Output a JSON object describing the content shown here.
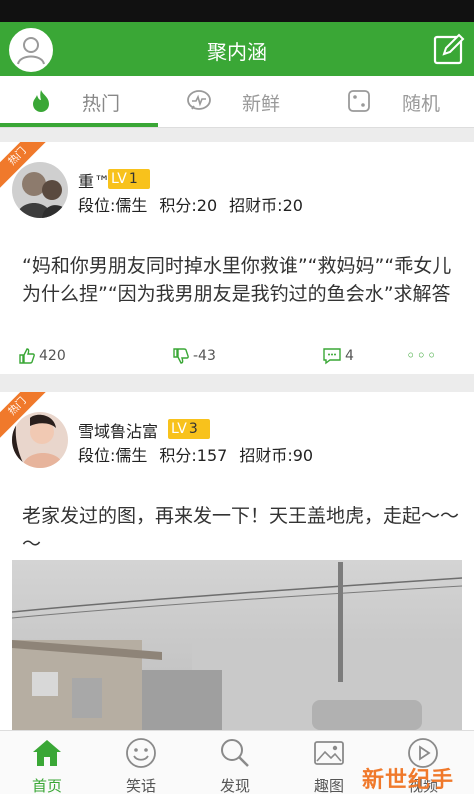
{
  "header": {
    "title": "聚内涵"
  },
  "tabs": [
    {
      "label": "热门",
      "icon": "flame-icon",
      "active": true
    },
    {
      "label": "新鲜",
      "icon": "chat-pulse-icon",
      "active": false
    },
    {
      "label": "随机",
      "icon": "dice-icon",
      "active": false
    }
  ],
  "posts": [
    {
      "hot_tag": "热门",
      "username": "重™",
      "level_prefix": "LV",
      "level": "1",
      "rank": "段位:儒生",
      "points": "积分:20",
      "coins": "招财币:20",
      "content": "“妈和你男朋友同时掉水里你救谁”“救妈妈”“乖女儿为什么捏”“因为我男朋友是我钓过的鱼会水”求解答",
      "likes": "420",
      "dislikes": "-43",
      "comments": "4",
      "more": "◦◦◦"
    },
    {
      "hot_tag": "热门",
      "username": "雪域鲁沾富",
      "level_prefix": "LV",
      "level": "3",
      "rank": "段位:儒生",
      "points": "积分:157",
      "coins": "招财币:90",
      "content": "老家发过的图，再来发一下！天王盖地虎，走起～～～"
    }
  ],
  "bottom_nav": [
    {
      "label": "首页",
      "icon": "home-icon",
      "active": true
    },
    {
      "label": "笑话",
      "icon": "smiley-icon",
      "active": false
    },
    {
      "label": "发现",
      "icon": "search-icon",
      "active": false
    },
    {
      "label": "趣图",
      "icon": "image-icon",
      "active": false
    },
    {
      "label": "视频",
      "icon": "play-icon",
      "active": false
    }
  ],
  "watermark": "新世纪手游",
  "colors": {
    "brand": "#3aa736",
    "hot": "#f0792b",
    "level": "#f8c21c"
  }
}
